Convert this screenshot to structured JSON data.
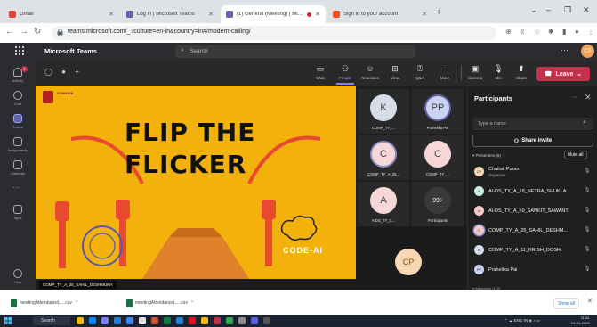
{
  "browser": {
    "tabs": [
      {
        "label": "Gmail",
        "color": "#ea4335"
      },
      {
        "label": "Log in | Microsoft Teams",
        "color": "#6264a7"
      },
      {
        "label": "(1) General (Meeting) | Microsoft Teams",
        "color": "#6264a7"
      },
      {
        "label": "Sign in to your account",
        "color": "#f25022"
      }
    ],
    "url": "teams.microsoft.com/_?culture=en-in&country=in#/modern-calling/"
  },
  "teams": {
    "app_name": "Microsoft Teams",
    "search_placeholder": "Search",
    "me_initials": "CP"
  },
  "rail": [
    {
      "label": "Activity",
      "badge": "1"
    },
    {
      "label": "Chat"
    },
    {
      "label": "Teams"
    },
    {
      "label": "Assignments"
    },
    {
      "label": "Calendar"
    },
    {
      "label": "Apps"
    },
    {
      "label": "Help"
    }
  ],
  "meeting_controls": {
    "chat": "Chat",
    "people": "People",
    "reactions": "Reactions",
    "view": "View",
    "qa": "Q&A",
    "more": "More",
    "camera": "Camera",
    "mic": "Mic",
    "share": "Share",
    "leave": "Leave"
  },
  "shared_screen": {
    "title_line1": "FLIP THE",
    "title_line2": "FLICKER",
    "brand": "CODE-AI",
    "presenter": "COMP_TY_A_25_SAHIL_DESHMUKH"
  },
  "video_tiles": [
    {
      "initials": "K",
      "label": "COMP_TY_...",
      "color": "#d6dde8"
    },
    {
      "initials": "PP",
      "label": "Prahelika Pai",
      "color": "#cbd3f2"
    },
    {
      "initials": "C",
      "label": "COMP_TY_A_25...",
      "color": "#f6d6d6"
    },
    {
      "initials": "C",
      "label": "COMP_TY_...",
      "color": "#f6d6d6"
    },
    {
      "initials": "A",
      "label": "AIDS_TY_C...",
      "color": "#f6d6d6"
    },
    {
      "initials": "99+",
      "label": "Participants",
      "color": "#3a3a3a"
    }
  ],
  "self_tile": {
    "initials": "CP"
  },
  "participants_panel": {
    "title": "Participants",
    "search_placeholder": "Type a name",
    "share_invite": "Share invite",
    "section_label": "Presenters (6)",
    "mute_all": "Mute all",
    "people": [
      {
        "initials": "CP",
        "name": "Chaitali Purao",
        "role": "Organizer",
        "color": "#f8d7b5"
      },
      {
        "initials": "A",
        "name": "AI-DS_TY_A_18_NETRA_SHUKLA",
        "role": "",
        "color": "#c8efe6"
      },
      {
        "initials": "A",
        "name": "AI-DS_TY_A_59_SANKIT_SAWANT",
        "role": "",
        "color": "#f6c9c9"
      },
      {
        "initials": "C",
        "name": "COMP_TY_A_25_SAHIL_DESHM...",
        "role": "",
        "color": "#f6c9c9"
      },
      {
        "initials": "K",
        "name": "COMP_TY_A_11_KRISH_DOSHI",
        "role": "",
        "color": "#d6dde8"
      },
      {
        "initials": "PP",
        "name": "Prahelika Pai",
        "role": "",
        "color": "#cbd3f2"
      }
    ],
    "attendees_label": "Attendees (122)"
  },
  "downloads": [
    {
      "label": "meetingAttendanceL....csv"
    },
    {
      "label": "meetingAttendanceL....csv"
    }
  ],
  "downloads_show_all": "Show all",
  "taskbar": {
    "search": "Search",
    "tray": "ENG IN",
    "time": "11:54",
    "date": "21-01-2023"
  }
}
